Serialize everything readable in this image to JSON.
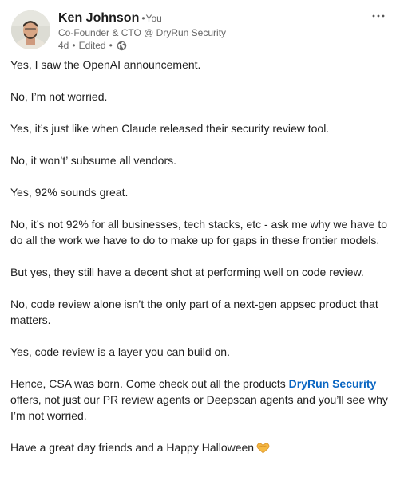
{
  "author": {
    "name": "Ken Johnson",
    "relation": "You",
    "headline": "Co-Founder & CTO @ DryRun Security",
    "age": "4d",
    "edited": "Edited",
    "visibility_icon": "globe-icon"
  },
  "menu": {
    "more_icon": "ellipsis-icon"
  },
  "post": {
    "p1": "Yes, I saw the OpenAI announcement.",
    "p2": "No, I’m not worried.",
    "p3": "Yes, it’s just like when Claude released their security review tool.",
    "p4": "No, it won’t’ subsume all vendors.",
    "p5": "Yes, 92% sounds great.",
    "p6": "No, it’s not 92% for all businesses, tech stacks, etc - ask me why we have to do all the work we have to do to make up for gaps in these frontier models.",
    "p7": "But yes, they still have a decent shot at performing well on code review.",
    "p8": "No, code review alone isn’t the only part of a next-gen appsec product that matters.",
    "p9": "Yes, code review is a layer you can build on.",
    "p10_before": "Hence, CSA was born. Come check out all the products ",
    "p10_mention": "DryRun Security",
    "p10_after": " offers, not just our PR review agents or Deepscan agents and you’ll see why I’m not worried.",
    "p11": "Have a great day friends and a Happy Halloween",
    "p11_emoji": "heart-hands-emoji"
  },
  "colors": {
    "link": "#0a66c2",
    "secondary_text": "#666666",
    "body_text": "#1f1f1f"
  }
}
